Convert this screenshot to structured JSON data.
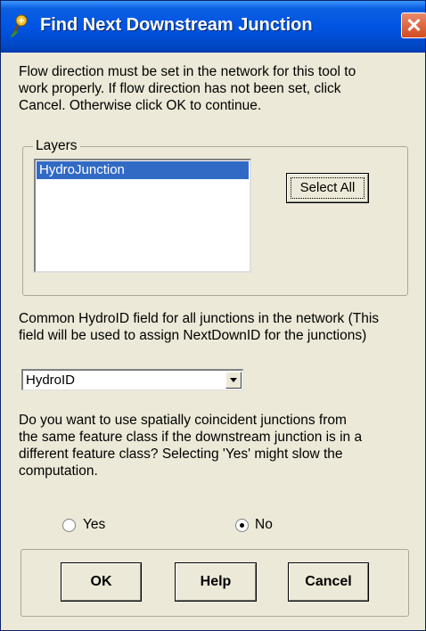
{
  "window": {
    "title": "Find Next Downstream Junction",
    "close_symbol": "✕",
    "title_icon": "hydro-tool-icon",
    "colors": {
      "titlebar": "#0054e3",
      "face": "#ece9d8",
      "selection": "#316ac5",
      "close": "#d24a1f"
    }
  },
  "intro": {
    "line1": "Flow direction must be set in the network for this tool to",
    "line2": "work properly. If flow direction has not been set, click",
    "line3": "Cancel. Otherwise click OK to continue."
  },
  "layers": {
    "legend": "Layers",
    "items": [
      "HydroJunction"
    ],
    "select_all": "Select All"
  },
  "hydroid": {
    "line1": "Common HydroID field for all junctions in the network (This",
    "line2": "field will be used to assign NextDownID for the junctions)",
    "value": "HydroID"
  },
  "coincident": {
    "line1": "Do you want to use spatially coincident junctions from",
    "line2": "the same feature class if the downstream junction is in a",
    "line3": "different feature class? Selecting 'Yes' might slow the",
    "line4": "computation.",
    "yes_label": "Yes",
    "no_label": "No",
    "selected": "No"
  },
  "buttons": {
    "ok": "OK",
    "help": "Help",
    "cancel": "Cancel"
  }
}
